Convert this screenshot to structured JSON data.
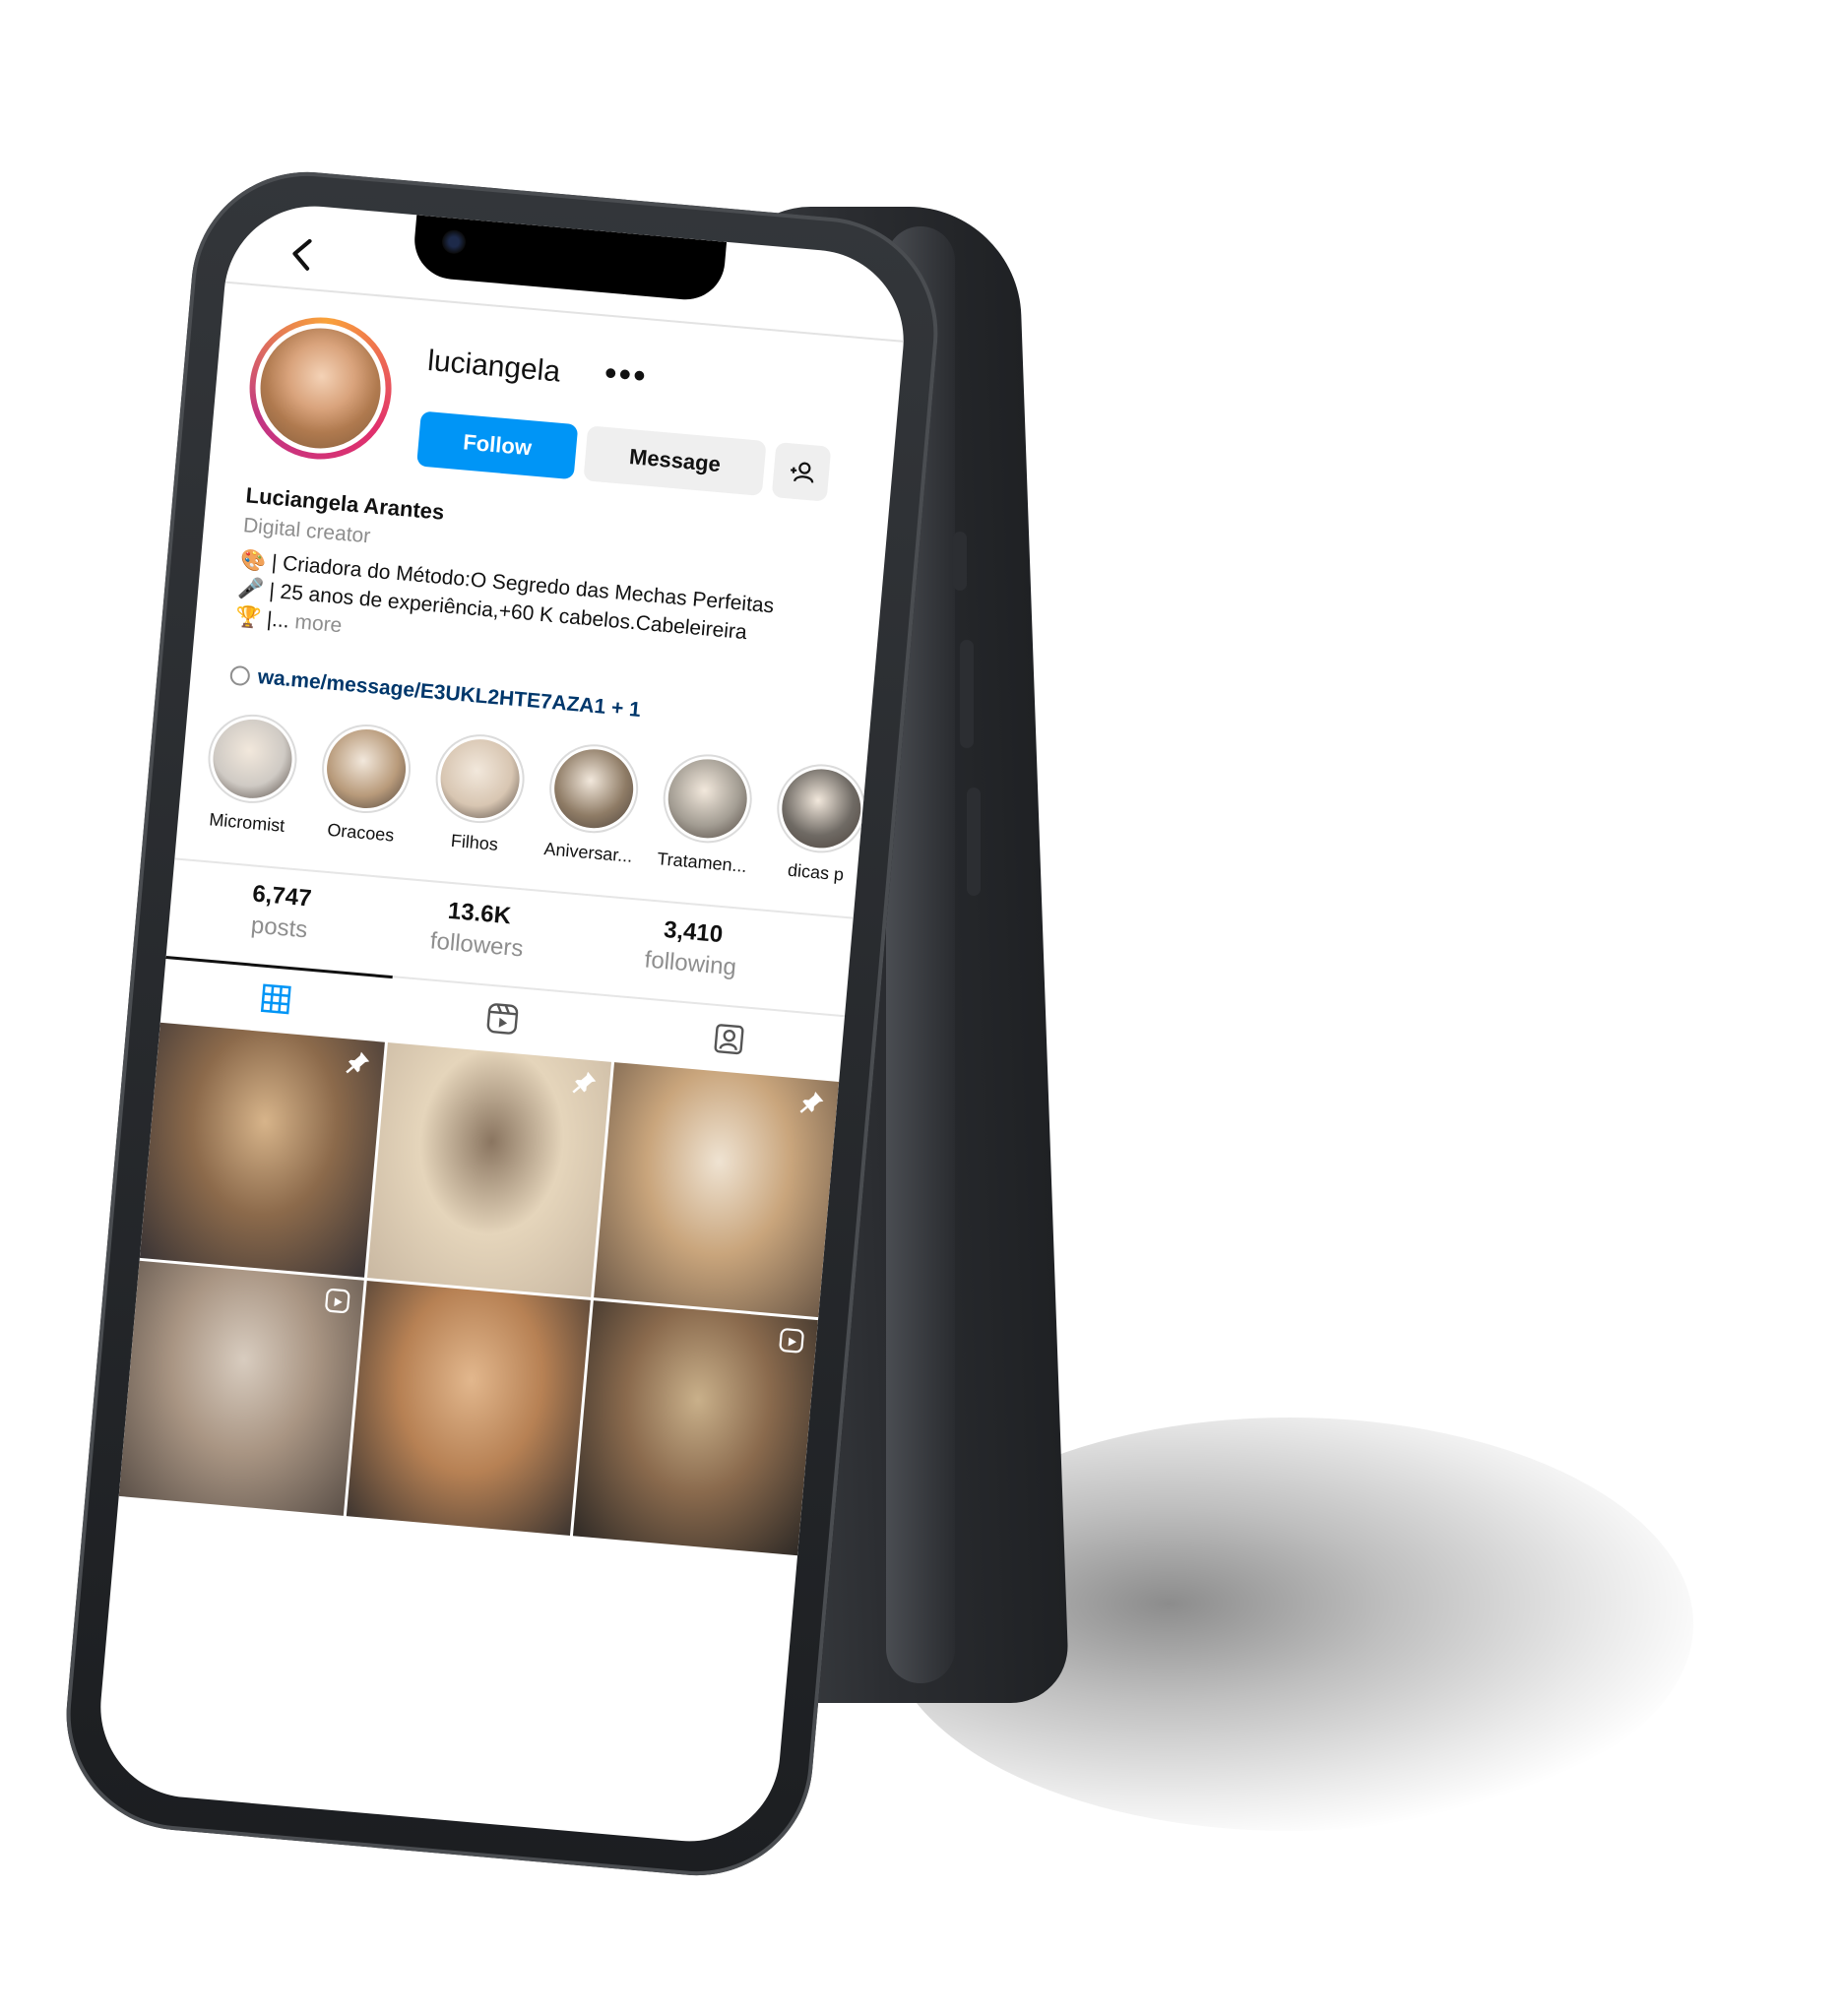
{
  "profile": {
    "username": "luciangela",
    "more_label": "•••",
    "full_name": "Luciangela Arantes",
    "category": "Digital creator",
    "bio_line1": "🎨 | Criadora do Método:O Segredo das Mechas Perfeitas",
    "bio_line2": "🎤 | 25 anos de experiência,+60 K cabelos.Cabeleireira",
    "bio_line3": "🏆 |...",
    "bio_more": "more",
    "link": "wa.me/message/E3UKL2HTE7AZA1 + 1"
  },
  "buttons": {
    "follow": "Follow",
    "message": "Message"
  },
  "highlights": [
    {
      "label": "Micromist",
      "color": "#cfcac4"
    },
    {
      "label": "Oracoes",
      "color": "#b89a7a"
    },
    {
      "label": "Filhos",
      "color": "#d8c6b2"
    },
    {
      "label": "Aniversar...",
      "color": "#8f7c66"
    },
    {
      "label": "Tratamen...",
      "color": "#a39d93"
    },
    {
      "label": "dicas p",
      "color": "#6f6a64"
    }
  ],
  "stats": {
    "posts_count": "6,747",
    "posts_label": "posts",
    "followers_count": "13.6K",
    "followers_label": "followers",
    "following_count": "3,410",
    "following_label": "following"
  },
  "tabs": [
    {
      "name": "grid-icon",
      "active": true
    },
    {
      "name": "reels-icon",
      "active": false
    },
    {
      "name": "tagged-icon",
      "active": false
    }
  ],
  "posts": [
    {
      "badge": "pin-icon",
      "colors": [
        "#3a3435",
        "#8c6a4b",
        "#d7b48a"
      ]
    },
    {
      "badge": "pin-icon",
      "colors": [
        "#c9b8a2",
        "#e5d5bb",
        "#8a7560"
      ]
    },
    {
      "badge": "pin-icon",
      "colors": [
        "#6e5a48",
        "#c9a57c",
        "#efe3d2"
      ]
    },
    {
      "badge": "reels-icon",
      "colors": [
        "#5b5048",
        "#a99583",
        "#d8ccbf"
      ]
    },
    {
      "badge": "",
      "colors": [
        "#3d3530",
        "#b78154",
        "#e2b78d"
      ]
    },
    {
      "badge": "reels-icon",
      "colors": [
        "#2f2a26",
        "#8a6a4d",
        "#c9b08a"
      ]
    }
  ],
  "colors": {
    "accent": "#0095f6",
    "link": "#00376b",
    "secondary_text": "#8e8e8e"
  }
}
